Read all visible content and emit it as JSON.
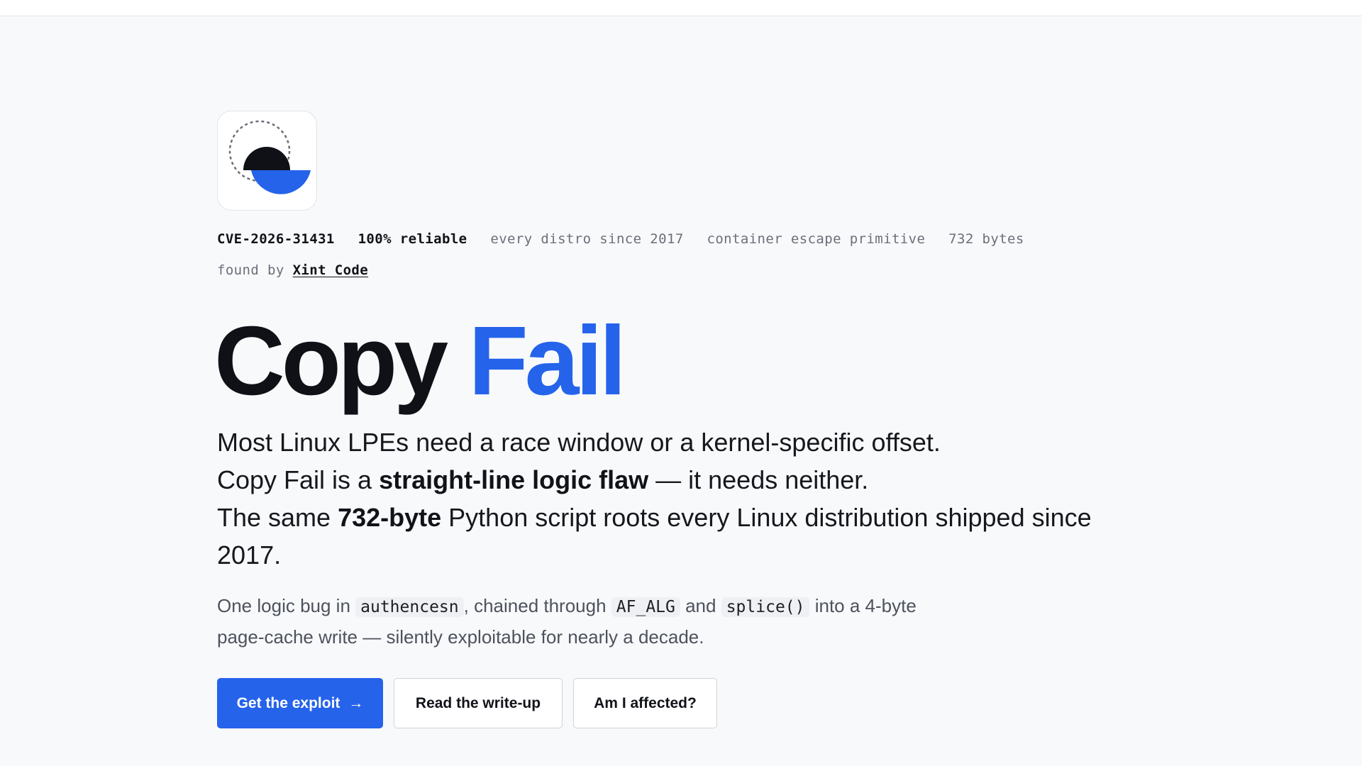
{
  "tags": {
    "cve": "CVE-2026-31431",
    "reliability": "100% reliable",
    "scope": "every distro since 2017",
    "impact": "container escape primitive",
    "size": "732 bytes",
    "found_by_label": "found by",
    "found_by_link": "Xint Code"
  },
  "title": {
    "word1": "Copy",
    "word2": "Fail"
  },
  "lead": {
    "line1": "Most Linux LPEs need a race window or a kernel-specific offset.",
    "line2_a": "Copy Fail is a ",
    "line2_b": "straight-line logic flaw",
    "line2_c": " — it needs neither.",
    "line3_a": "The same ",
    "line3_b": "732-byte",
    "line3_c": " Python script roots every Linux distribution shipped since 2017."
  },
  "sub": {
    "t1": "One logic bug in ",
    "c1": "authencesn",
    "t2": ", chained through ",
    "c2": "AF_ALG",
    "t3": " and ",
    "c3": "splice()",
    "t4": " into a 4-byte page-cache write — silently exploitable for nearly a decade."
  },
  "buttons": {
    "primary": "Get the exploit",
    "primary_arrow": "→",
    "writeup": "Read the write-up",
    "affected": "Am I affected?"
  },
  "colors": {
    "accent": "#2563eb",
    "ink": "#111318",
    "muted": "#6b6f78",
    "background": "#f8f9fb"
  },
  "icons": {
    "logo": "half-circles-logo-icon",
    "arrow": "arrow-right-icon"
  }
}
